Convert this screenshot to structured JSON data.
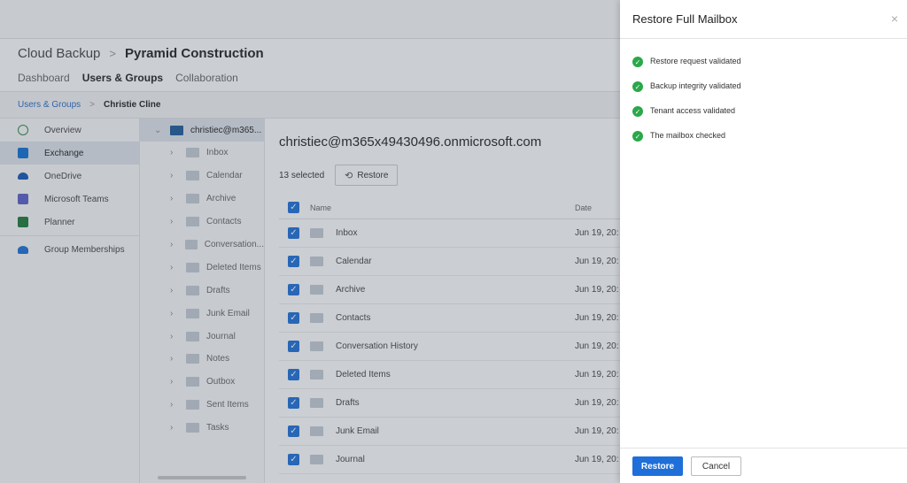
{
  "header": {
    "root": "Cloud Backup",
    "separator": ">",
    "current": "Pyramid Construction",
    "tabs": [
      {
        "label": "Dashboard"
      },
      {
        "label": "Users & Groups"
      },
      {
        "label": "Collaboration"
      }
    ]
  },
  "breadcrumb": {
    "parent": "Users & Groups",
    "separator": ">",
    "current": "Christie Cline"
  },
  "sidebar": {
    "items": [
      {
        "label": "Overview",
        "icon": "history-icon",
        "color": "#2f8a4a"
      },
      {
        "label": "Exchange",
        "icon": "exchange-icon",
        "color": "#0e6fd4"
      },
      {
        "label": "OneDrive",
        "icon": "onedrive-icon",
        "color": "#1257b8"
      },
      {
        "label": "Microsoft Teams",
        "icon": "teams-icon",
        "color": "#5b5fc7"
      },
      {
        "label": "Planner",
        "icon": "planner-icon",
        "color": "#1d7a3a"
      },
      {
        "label": "Group Memberships",
        "icon": "group-icon",
        "color": "#1e6fd9"
      }
    ]
  },
  "tree": {
    "root": "christiec@m365...",
    "items": [
      "Inbox",
      "Calendar",
      "Archive",
      "Contacts",
      "Conversation...",
      "Deleted Items",
      "Drafts",
      "Junk Email",
      "Journal",
      "Notes",
      "Outbox",
      "Sent Items",
      "Tasks"
    ]
  },
  "main": {
    "title": "christiec@m365x49430496.onmicrosoft.com",
    "selected_text": "13 selected",
    "restore_label": "Restore",
    "columns": {
      "name": "Name",
      "date": "Date"
    },
    "rows": [
      {
        "name": "Inbox",
        "date": "Jun 19, 20:"
      },
      {
        "name": "Calendar",
        "date": "Jun 19, 20:"
      },
      {
        "name": "Archive",
        "date": "Jun 19, 20:"
      },
      {
        "name": "Contacts",
        "date": "Jun 19, 20:"
      },
      {
        "name": "Conversation History",
        "date": "Jun 19, 20:"
      },
      {
        "name": "Deleted Items",
        "date": "Jun 19, 20:"
      },
      {
        "name": "Drafts",
        "date": "Jun 19, 20:"
      },
      {
        "name": "Junk Email",
        "date": "Jun 19, 20:"
      },
      {
        "name": "Journal",
        "date": "Jun 19, 20:"
      }
    ]
  },
  "panel": {
    "title": "Restore Full Mailbox",
    "close": "×",
    "checks": [
      {
        "label": "Restore request validated"
      },
      {
        "label": "Backup integrity validated"
      },
      {
        "label": "Tenant access validated"
      },
      {
        "label": "The mailbox checked"
      }
    ],
    "restore_label": "Restore",
    "cancel_label": "Cancel"
  }
}
